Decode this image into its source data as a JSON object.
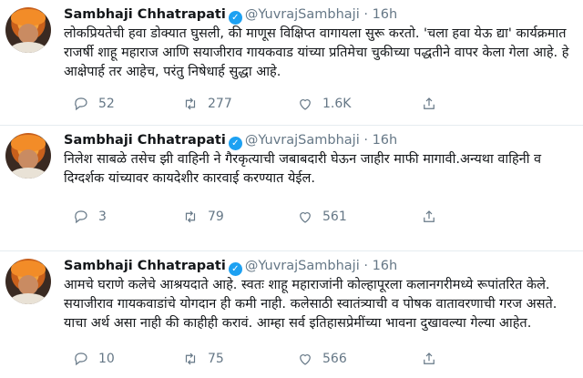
{
  "tweets": [
    {
      "name": "Sambhaji Chhatrapati",
      "handle": "@YuvrajSambhaji",
      "separator": "·",
      "time": "16h",
      "text": "लोकप्रियतेची हवा डोक्यात घुसली, की माणूस विक्षिप्त वागायला सुरू करतो. 'चला हवा येऊ द्या' कार्यक्रमात राजर्षी शाहू महाराज आणि सयाजीराव गायकवाड यांच्या प्रतिमेचा चुकीच्या पद्धतीने वापर केला गेला आहे. हे आक्षेपार्ह तर आहेच, परंतु निषेधार्ह सुद्धा आहे.",
      "replies": "52",
      "retweets": "277",
      "likes": "1.6K"
    },
    {
      "name": "Sambhaji Chhatrapati",
      "handle": "@YuvrajSambhaji",
      "separator": "·",
      "time": "16h",
      "text": "निलेश साबळे तसेच झी वाहिनी ने गैरकृत्याची जबाबदारी घेऊन जाहीर माफी मागावी.अन्यथा वाहिनी व दिग्दर्शक यांच्यावर कायदेशीर कारवाई करण्यात येईल.",
      "replies": "3",
      "retweets": "79",
      "likes": "561"
    },
    {
      "name": "Sambhaji Chhatrapati",
      "handle": "@YuvrajSambhaji",
      "separator": "·",
      "time": "16h",
      "text": "आमचे घराणे कलेचे आश्रयदाते आहे. स्वतः शाहू महाराजांनी कोल्हापूरला कलानगरीमध्ये रूपांतरित केले. सयाजीराव गायकवाडांचे योगदान ही कमी नाही. कलेसाठी स्वातंत्र्याची व पोषक वातावरणाची गरज असते. याचा अर्थ असा नाही की काहीही करावं. आम्हा सर्व इतिहासप्रेमींच्या भावना दुखावल्या गेल्या आहेत.",
      "replies": "10",
      "retweets": "75",
      "likes": "566"
    }
  ],
  "icons": {
    "verified": "verified-badge-icon",
    "reply": "reply-icon",
    "retweet": "retweet-icon",
    "like": "like-icon",
    "share": "share-icon"
  },
  "colors": {
    "verified": "#1da1f2",
    "secondary_text": "#657786",
    "primary_text": "#14171a"
  }
}
